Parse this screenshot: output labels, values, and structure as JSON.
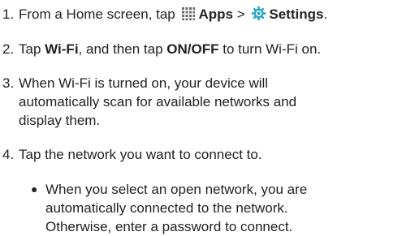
{
  "steps": [
    {
      "number": "1.",
      "parts": {
        "a": "From a Home screen, tap",
        "apps": "Apps",
        "sep": ">",
        "settings": "Settings",
        "end": "."
      },
      "icons": [
        "apps-icon",
        "settings-icon"
      ]
    },
    {
      "number": "2.",
      "parts": {
        "a": "Tap",
        "wifi": "Wi-Fi",
        "b": ", and then tap",
        "onoff": "ON/OFF",
        "c": "to turn Wi-Fi on."
      }
    },
    {
      "number": "3.",
      "lines": [
        "When Wi-Fi is turned on, your device will",
        "automatically scan for available networks and",
        "display them."
      ]
    },
    {
      "number": "4.",
      "lines": [
        "Tap the network you want to connect to."
      ],
      "bullets": [
        {
          "lines": [
            "When you select an open network, you are",
            "automatically connected to the network.",
            "Otherwise, enter a password to connect."
          ]
        }
      ]
    }
  ],
  "colors": {
    "text": "#222222",
    "apps_icon": "#6a6a6a",
    "settings_icon": "#2aa7c9"
  }
}
